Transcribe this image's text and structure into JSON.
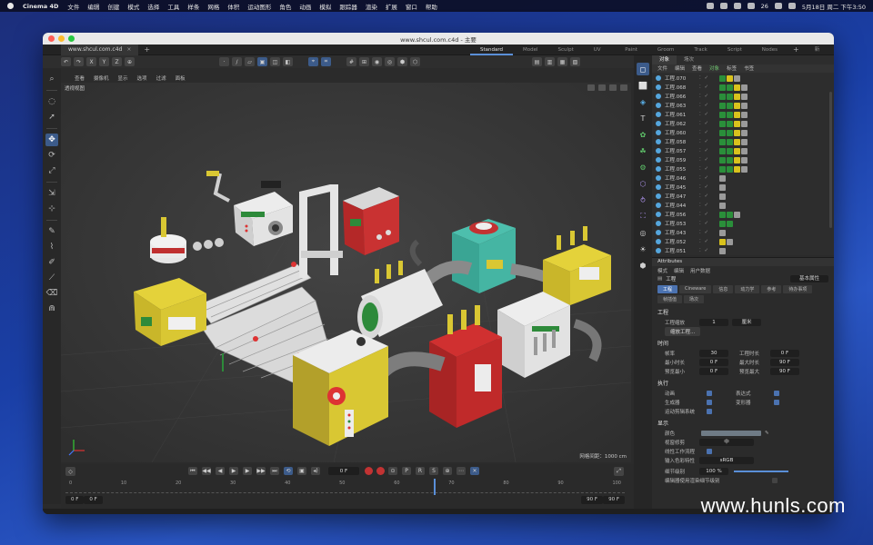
{
  "menubar": {
    "app": "Cinema 4D",
    "items": [
      "文件",
      "编辑",
      "创建",
      "模式",
      "选择",
      "工具",
      "样条",
      "网格",
      "体积",
      "运动图形",
      "角色",
      "动画",
      "模拟",
      "跟踪器",
      "渲染",
      "扩展",
      "窗口",
      "帮助"
    ],
    "battery": "26",
    "clock": "5月18日 周二 下午3:50"
  },
  "window": {
    "title": "www.shcul.com.c4d - 主要",
    "doc_tab": "www.shcul.com.c4d",
    "layouts": [
      "Standard",
      "Model",
      "Sculpt",
      "UV Edit",
      "Paint",
      "Groom",
      "Track",
      "Script",
      "Nodes"
    ],
    "new_layout": "+",
    "new_layout_label": "新布局"
  },
  "viewport": {
    "menu": [
      "查看",
      "摄像机",
      "显示",
      "选项",
      "过滤",
      "面板"
    ],
    "camera_label": "透视视图",
    "grid_distance": "网格间距：1000 cm"
  },
  "timeline": {
    "current_frame": "0 F",
    "ruler": [
      "0",
      "10",
      "20",
      "30",
      "40",
      "50",
      "60",
      "70",
      "80",
      "90",
      "100"
    ],
    "start_frame": "0 F",
    "end_frame_left": "0 F",
    "end_frame_right": "90 F",
    "end_frame_max": "90 F"
  },
  "object_manager": {
    "tabs": [
      "对象",
      "场次"
    ],
    "menu": [
      "文件",
      "编辑",
      "查看",
      "对象",
      "标签",
      "书签"
    ],
    "rows": [
      {
        "name": "工程.070",
        "highlight": false,
        "tags": [
          "#2a8f3a",
          "#d9c21d",
          "#9a9a9a"
        ]
      },
      {
        "name": "工程.068",
        "highlight": false,
        "tags": [
          "#2a8f3a",
          "#2a8f3a",
          "#d9c21d",
          "#9a9a9a"
        ]
      },
      {
        "name": "工程.066",
        "highlight": false,
        "tags": [
          "#2a8f3a",
          "#2a8f3a",
          "#d9c21d",
          "#9a9a9a"
        ]
      },
      {
        "name": "工程.063",
        "highlight": false,
        "tags": [
          "#2a8f3a",
          "#2a8f3a",
          "#d9c21d",
          "#9a9a9a"
        ]
      },
      {
        "name": "工程.061",
        "highlight": false,
        "tags": [
          "#2a8f3a",
          "#2a8f3a",
          "#d9c21d",
          "#9a9a9a"
        ]
      },
      {
        "name": "工程.062",
        "highlight": false,
        "tags": [
          "#2a8f3a",
          "#2a8f3a",
          "#d9c21d",
          "#9a9a9a"
        ]
      },
      {
        "name": "工程.060",
        "highlight": false,
        "tags": [
          "#2a8f3a",
          "#2a8f3a",
          "#d9c21d",
          "#9a9a9a"
        ]
      },
      {
        "name": "工程.058",
        "highlight": false,
        "tags": [
          "#2a8f3a",
          "#2a8f3a",
          "#d9c21d",
          "#9a9a9a"
        ]
      },
      {
        "name": "工程.057",
        "highlight": false,
        "tags": [
          "#2a8f3a",
          "#2a8f3a",
          "#d9c21d",
          "#9a9a9a"
        ]
      },
      {
        "name": "工程.059",
        "highlight": false,
        "tags": [
          "#2a8f3a",
          "#2a8f3a",
          "#d9c21d",
          "#9a9a9a"
        ]
      },
      {
        "name": "工程.055",
        "highlight": false,
        "tags": [
          "#2a8f3a",
          "#2a8f3a",
          "#d9c21d",
          "#9a9a9a"
        ]
      },
      {
        "name": "工程.046",
        "highlight": false,
        "tags": [
          "#9a9a9a"
        ]
      },
      {
        "name": "工程.045",
        "highlight": false,
        "tags": [
          "#9a9a9a"
        ]
      },
      {
        "name": "工程.047",
        "highlight": false,
        "tags": [
          "#9a9a9a"
        ]
      },
      {
        "name": "工程.044",
        "highlight": false,
        "tags": [
          "#9a9a9a"
        ]
      },
      {
        "name": "工程.056",
        "highlight": false,
        "tags": [
          "#2a8f3a",
          "#2a8f3a",
          "#9a9a9a"
        ]
      },
      {
        "name": "工程.053",
        "highlight": false,
        "tags": [
          "#2a8f3a",
          "#2a8f3a"
        ]
      },
      {
        "name": "工程.043",
        "highlight": false,
        "tags": [
          "#9a9a9a"
        ]
      },
      {
        "name": "工程.052",
        "highlight": false,
        "tags": [
          "#d9c21d",
          "#9a9a9a"
        ]
      },
      {
        "name": "工程.051",
        "highlight": false,
        "tags": [
          "#9a9a9a"
        ]
      },
      {
        "name": "工程.041",
        "highlight": false,
        "tags": [
          "#9a9a9a"
        ]
      }
    ]
  },
  "attributes": {
    "header": "Attributes",
    "menu": [
      "模式",
      "编辑",
      "用户数据"
    ],
    "object_name": "工程",
    "mode_select": "基本属性",
    "tabs": [
      "工程",
      "Cineware",
      "信息",
      "动力学",
      "参考",
      "待办事项",
      "帧插值",
      "场次"
    ],
    "section_project": "工程",
    "scale_label": "工程缩放",
    "scale_value": "1",
    "scale_unit": "厘米",
    "scale_button": "缩放工程...",
    "section_time": "时间",
    "fps_label": "帧率",
    "fps_value": "30",
    "project_time_label": "工程时长",
    "project_time_value": "0 F",
    "min_time_label": "最小时长",
    "min_time_value": "0 F",
    "max_time_label": "最大时长",
    "max_time_value": "90 F",
    "preview_min_label": "预览最小",
    "preview_min_value": "0 F",
    "preview_max_label": "预览最大",
    "preview_max_value": "90 F",
    "section_exec": "执行",
    "anim_label": "动画",
    "expr_label": "表达式",
    "gen_label": "生成器",
    "deform_label": "变形器",
    "motion_label": "运动剪辑系统",
    "section_display": "显示",
    "color_label": "颜色",
    "viewport_clip_label": "视窗修剪",
    "viewport_clip_value": "中",
    "linear_workflow_label": "线性工作流程",
    "color_profile_label": "输入色彩特性",
    "color_profile_value": "sRGB",
    "lod_label": "细节级别",
    "lod_value": "100 %",
    "lod_render_label": "编辑器使用渲染细节级别"
  },
  "watermark": "www.hunls.com"
}
